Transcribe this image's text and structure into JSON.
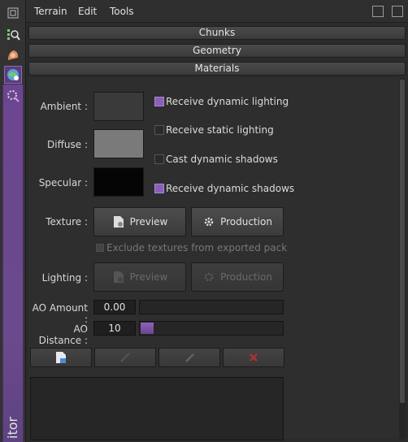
{
  "menu": {
    "terrain": "Terrain",
    "edit": "Edit",
    "tools": "Tools"
  },
  "sidebar": {
    "vertical_label": "itor"
  },
  "sections": {
    "chunks": "Chunks",
    "geometry": "Geometry",
    "materials": "Materials"
  },
  "materials": {
    "ambient_label": "Ambient :",
    "diffuse_label": "Diffuse :",
    "specular_label": "Specular :",
    "ambient_color": "#3a3a3a",
    "diffuse_color": "#7a7a7a",
    "specular_color": "#050505",
    "checkboxes": [
      {
        "label": "Receive dynamic lighting",
        "checked": true
      },
      {
        "label": "Receive static lighting",
        "checked": false
      },
      {
        "label": "Cast dynamic shadows",
        "checked": false
      },
      {
        "label": "Receive dynamic shadows",
        "checked": true
      }
    ],
    "texture_label": "Texture :",
    "preview_label": "Preview",
    "production_label": "Production",
    "exclude_label": "Exclude textures from exported pack",
    "lighting_label": "Lighting :",
    "lighting_preview_label": "Preview",
    "lighting_production_label": "Production",
    "ao_amount_label": "AO Amount :",
    "ao_amount_value": "0.00",
    "ao_amount_fraction": 0.0,
    "ao_distance_label": "AO Distance :",
    "ao_distance_value": "10",
    "ao_distance_fraction": 0.09
  },
  "colors": {
    "accent": "#8a5fb8",
    "delete": "#c0392b"
  }
}
